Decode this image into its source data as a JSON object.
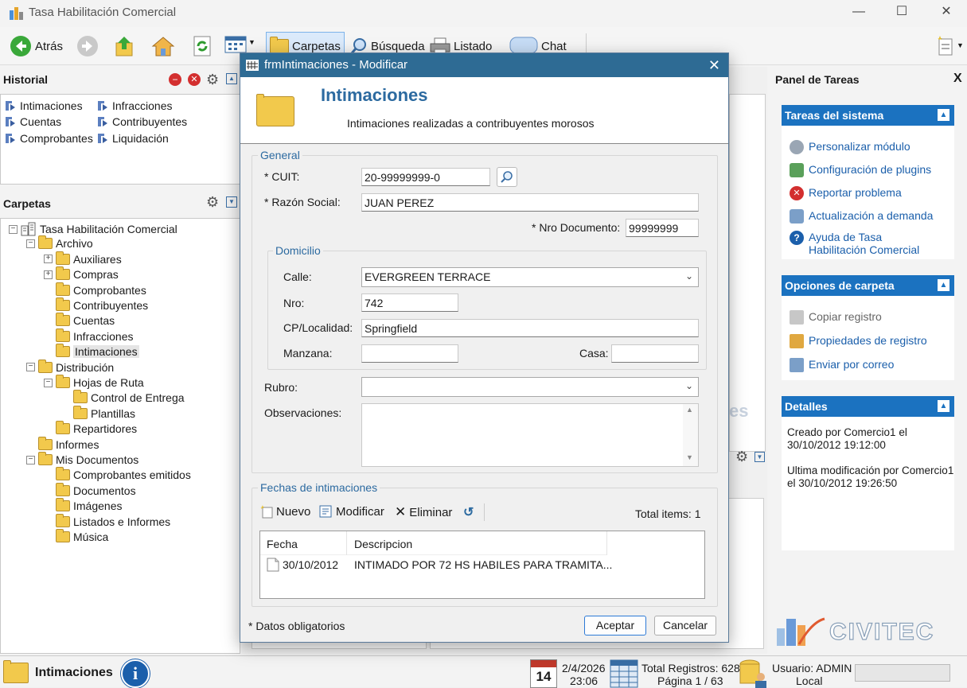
{
  "app": {
    "title": "Tasa Habilitación Comercial"
  },
  "toolbar": {
    "back": "Atrás",
    "folders": "Carpetas",
    "search": "Búsqueda",
    "listing": "Listado",
    "chat": "Chat"
  },
  "history": {
    "title": "Historial",
    "links": [
      "Intimaciones",
      "Infracciones",
      "Cuentas",
      "Contribuyentes",
      "Comprobantes",
      "Liquidación"
    ]
  },
  "folders": {
    "title": "Carpetas",
    "tree": [
      {
        "label": "Tasa Habilitación Comercial",
        "level": 0,
        "exp": "−"
      },
      {
        "label": "Archivo",
        "level": 1,
        "exp": "−"
      },
      {
        "label": "Auxiliares",
        "level": 2,
        "exp": "+"
      },
      {
        "label": "Compras",
        "level": 2,
        "exp": "+"
      },
      {
        "label": "Comprobantes",
        "level": 2,
        "exp": ""
      },
      {
        "label": "Contribuyentes",
        "level": 2,
        "exp": ""
      },
      {
        "label": "Cuentas",
        "level": 2,
        "exp": ""
      },
      {
        "label": "Infracciones",
        "level": 2,
        "exp": ""
      },
      {
        "label": "Intimaciones",
        "level": 2,
        "exp": "",
        "selected": true
      },
      {
        "label": "Distribución",
        "level": 1,
        "exp": "−"
      },
      {
        "label": "Hojas de Ruta",
        "level": 2,
        "exp": "−"
      },
      {
        "label": "Control de Entrega",
        "level": 3,
        "exp": ""
      },
      {
        "label": "Plantillas",
        "level": 3,
        "exp": ""
      },
      {
        "label": "Repartidores",
        "level": 2,
        "exp": ""
      },
      {
        "label": "Informes",
        "level": 1,
        "exp": ""
      },
      {
        "label": "Mis Documentos",
        "level": 1,
        "exp": "−"
      },
      {
        "label": "Comprobantes emitidos",
        "level": 2,
        "exp": ""
      },
      {
        "label": "Documentos",
        "level": 2,
        "exp": ""
      },
      {
        "label": "Imágenes",
        "level": 2,
        "exp": ""
      },
      {
        "label": "Listados e Informes",
        "level": 2,
        "exp": ""
      },
      {
        "label": "Música",
        "level": 2,
        "exp": ""
      }
    ]
  },
  "tasks": {
    "title": "Panel de Tareas",
    "system": {
      "title": "Tareas del sistema",
      "items": [
        "Personalizar módulo",
        "Configuración de plugins",
        "Reportar problema",
        "Actualización a demanda",
        "Ayuda de Tasa Habilitación Comercial"
      ]
    },
    "folder": {
      "title": "Opciones de carpeta",
      "items": [
        "Copiar registro",
        "Propiedades de registro",
        "Enviar por correo"
      ]
    },
    "details": {
      "title": "Detalles",
      "created": "Creado por Comercio1 el 30/10/2012 19:12:00",
      "modified": "Ultima modificación por Comercio1 el 30/10/2012 19:26:50"
    }
  },
  "dialog": {
    "title": "frmIntimaciones - Modificar",
    "heading": "Intimaciones",
    "subheading": "Intimaciones realizadas a contribuyentes morosos",
    "general": "General",
    "cuit_label": "* CUIT:",
    "cuit": "20-99999999-0",
    "razon_label": "* Razón Social:",
    "razon": "JUAN PEREZ",
    "nrodoc_label": "* Nro Documento:",
    "nrodoc": "99999999",
    "domicilio": "Domicilio",
    "calle_label": "Calle:",
    "calle": "EVERGREEN TERRACE",
    "nro_label": "Nro:",
    "nro": "742",
    "cp_label": "CP/Localidad:",
    "cp": "Springfield",
    "manzana_label": "Manzana:",
    "manzana": "",
    "casa_label": "Casa:",
    "casa": "",
    "rubro_label": "Rubro:",
    "rubro": "",
    "obs_label": "Observaciones:",
    "obs": "",
    "fechas": "Fechas de intimaciones",
    "new": "Nuevo",
    "modify": "Modificar",
    "delete": "Eliminar",
    "total": "Total items: 1",
    "columns": [
      "Fecha",
      "Descripcion"
    ],
    "rows": [
      {
        "fecha": "30/10/2012",
        "desc": "INTIMADO POR 72 HS HABILES PARA TRAMITA..."
      }
    ],
    "required_note": "* Datos obligatorios",
    "accept": "Aceptar",
    "cancel": "Cancelar"
  },
  "status": {
    "current": "Intimaciones",
    "cal_day": "14",
    "date": "2/4/2026",
    "time": "23:06",
    "total": "Total Registros: 628",
    "page": "Página 1 / 63",
    "user": "Usuario: ADMIN",
    "location": "Local"
  },
  "brand": {
    "logo": "CIVITEC",
    "bg_text": "es"
  }
}
